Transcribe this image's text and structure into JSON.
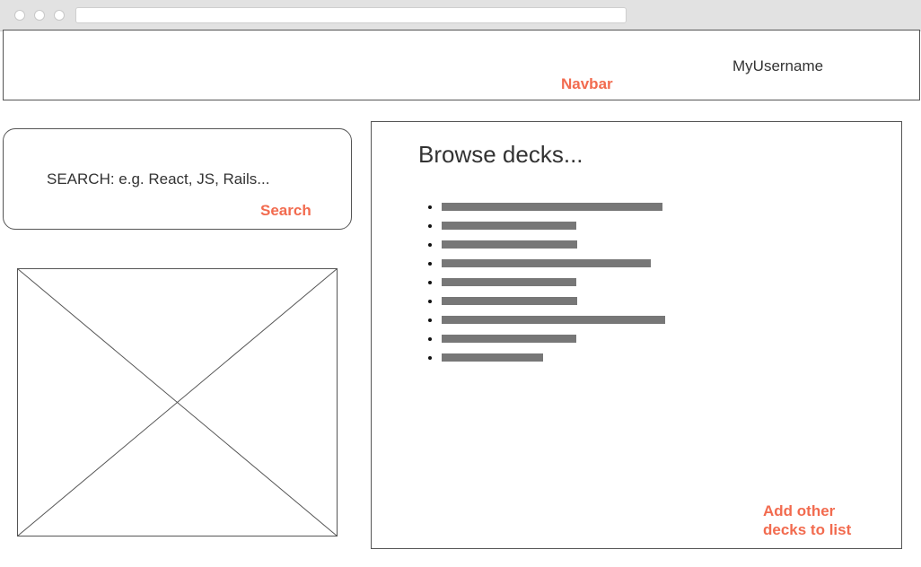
{
  "navbar": {
    "username": "MyUsername",
    "annotation": "Navbar"
  },
  "search": {
    "placeholder": "SEARCH: e.g. React, JS, Rails...",
    "annotation": "Search"
  },
  "browse": {
    "title": "Browse decks...",
    "annotation_line1": "Add other",
    "annotation_line2": "decks to list",
    "deck_count": 9
  },
  "colors": {
    "annotation": "#f26b4f",
    "placeholder_bar": "#777777",
    "border": "#555555"
  }
}
